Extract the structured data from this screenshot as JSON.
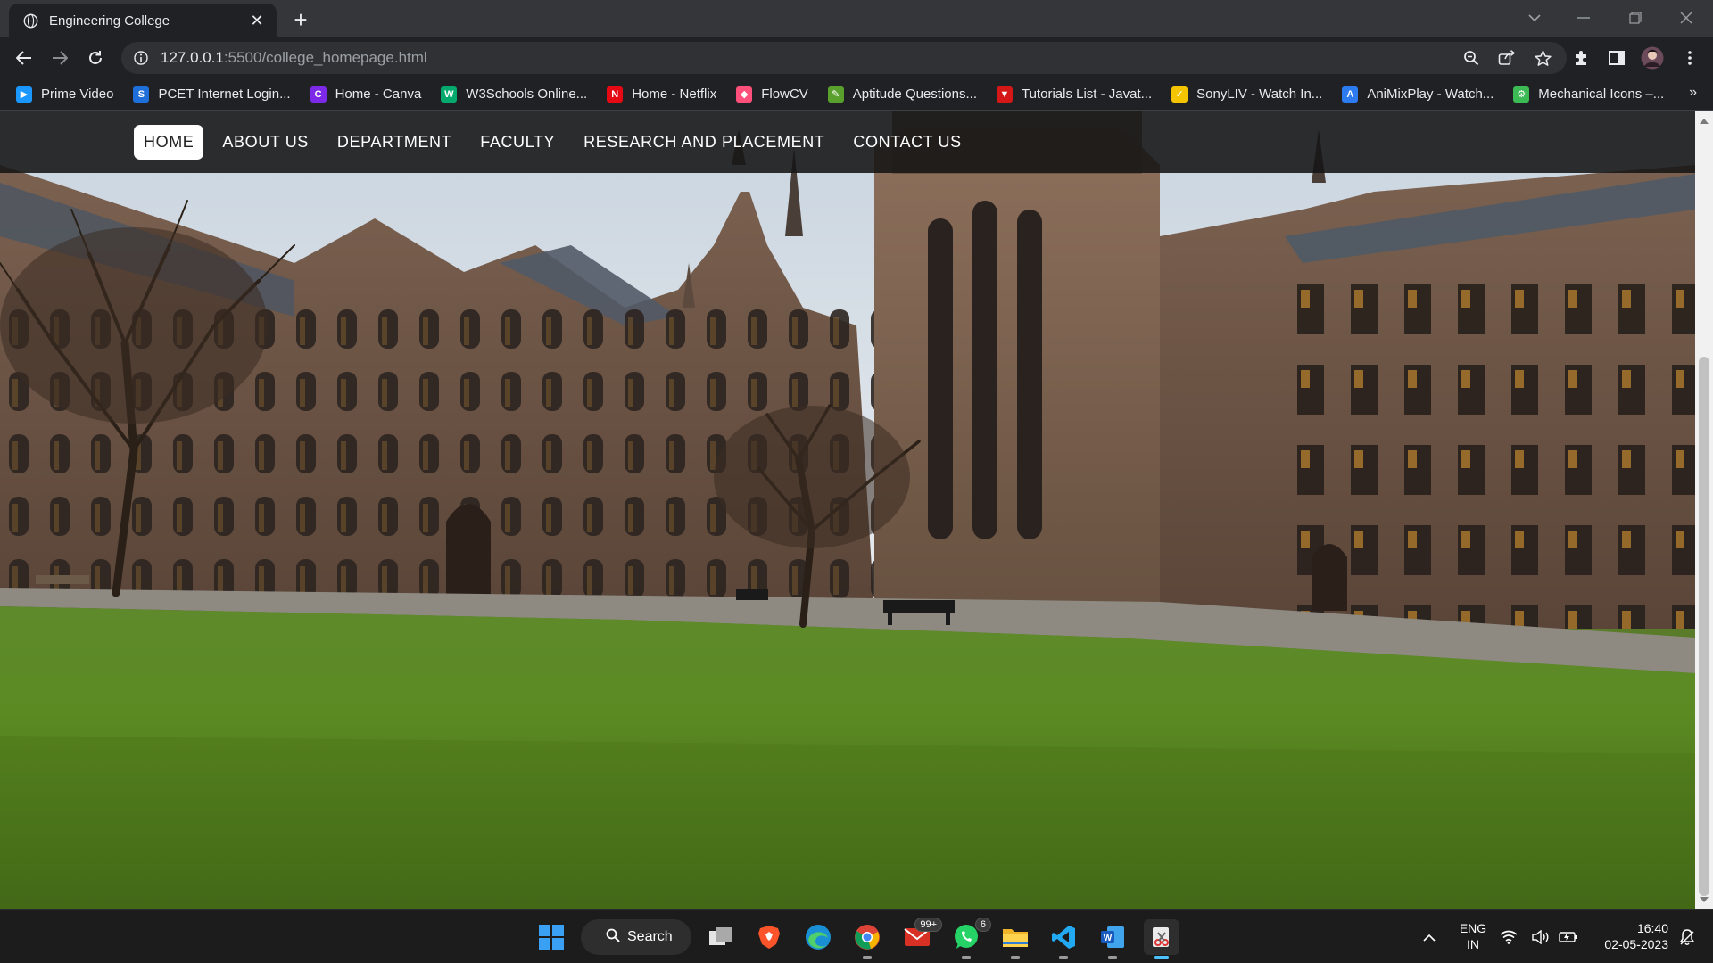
{
  "browser": {
    "tab": {
      "title": "Engineering College",
      "close_glyph": "✕"
    },
    "new_tab_glyph": "+",
    "url": {
      "host": "127.0.0.1",
      "rest": ":5500/college_homepage.html"
    },
    "bookmarks": [
      {
        "label": "Prime Video",
        "color": "#1a98ff",
        "glyph": "▶"
      },
      {
        "label": "PCET Internet Login...",
        "color": "#1e6fd9",
        "glyph": "S"
      },
      {
        "label": "Home - Canva",
        "color": "#7d2ae8",
        "glyph": "C"
      },
      {
        "label": "W3Schools Online...",
        "color": "#04aa6d",
        "glyph": "W"
      },
      {
        "label": "Home - Netflix",
        "color": "#e50914",
        "glyph": "N"
      },
      {
        "label": "FlowCV",
        "color": "#ff4f7a",
        "glyph": "◆"
      },
      {
        "label": "Aptitude Questions...",
        "color": "#5aa02c",
        "glyph": "✎"
      },
      {
        "label": "Tutorials List - Javat...",
        "color": "#d41818",
        "glyph": "▼"
      },
      {
        "label": "SonyLIV - Watch In...",
        "color": "#f5c400",
        "glyph": "✓"
      },
      {
        "label": "AniMixPlay - Watch...",
        "color": "#2d7bf0",
        "glyph": "A"
      },
      {
        "label": "Mechanical Icons –...",
        "color": "#3cba54",
        "glyph": "⚙"
      }
    ],
    "more_bookmarks_glyph": "»"
  },
  "site": {
    "nav": [
      {
        "label": "HOME",
        "active": true
      },
      {
        "label": "ABOUT US",
        "active": false
      },
      {
        "label": "DEPARTMENT",
        "active": false
      },
      {
        "label": "FACULTY",
        "active": false
      },
      {
        "label": "RESEARCH AND PLACEMENT",
        "active": false
      },
      {
        "label": "CONTACT US",
        "active": false
      }
    ]
  },
  "taskbar": {
    "search_label": "Search",
    "mail_badge": "99+",
    "whatsapp_badge": "6",
    "language": {
      "line1": "ENG",
      "line2": "IN"
    },
    "clock": {
      "time": "16:40",
      "date": "02-05-2023"
    }
  }
}
